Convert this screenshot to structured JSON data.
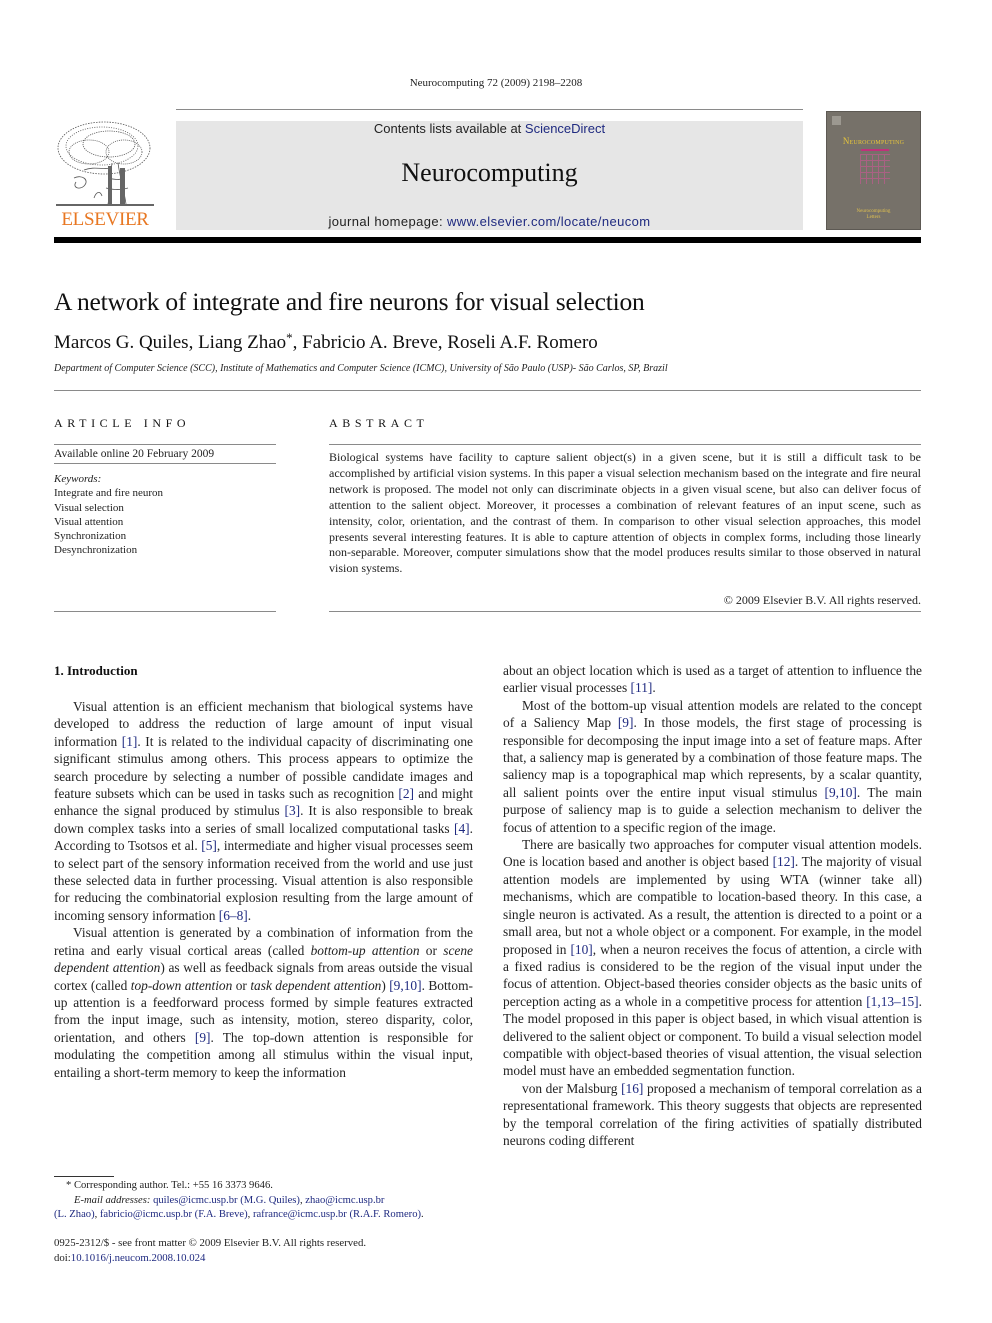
{
  "running_head": "Neurocomputing 72 (2009) 2198–2208",
  "publisher": {
    "logo_icon": "elsevier-tree-logo",
    "wordmark": "ELSEVIER",
    "brand_color": "#e87722"
  },
  "masthead": {
    "contents_prefix": "Contents lists available at ",
    "contents_link": "ScienceDirect",
    "journal_name": "Neurocomputing",
    "homepage_prefix": "journal homepage: ",
    "homepage_link": "www.elsevier.com/locate/neucom",
    "link_color": "#1f2a80",
    "background": "#e6e6e6"
  },
  "cover": {
    "title": "Neurocomputing",
    "subtitle_line1": "Neurocomputing",
    "subtitle_line2": "Letters"
  },
  "paper": {
    "title": "A network of integrate and fire neurons for visual selection",
    "authors": [
      {
        "name": "Marcos G. Quiles",
        "mark": ""
      },
      {
        "name": "Liang Zhao",
        "mark": "*"
      },
      {
        "name": "Fabricio A. Breve",
        "mark": ""
      },
      {
        "name": "Roseli A.F. Romero",
        "mark": ""
      }
    ],
    "affiliation": "Department of Computer Science (SCC), Institute of Mathematics and Computer Science (ICMC), University of São Paulo (USP)- São Carlos, SP, Brazil"
  },
  "article_info": {
    "heading": "ARTICLE INFO",
    "available": "Available online 20 February 2009",
    "keywords_label": "Keywords:",
    "keywords": [
      "Integrate and fire neuron",
      "Visual selection",
      "Visual attention",
      "Synchronization",
      "Desynchronization"
    ]
  },
  "abstract": {
    "heading": "ABSTRACT",
    "text": "Biological systems have facility to capture salient object(s) in a given scene, but it is still a difficult task to be accomplished by artificial vision systems. In this paper a visual selection mechanism based on the integrate and fire neural network is proposed. The model not only can discriminate objects in a given visual scene, but also can deliver focus of attention to the salient object. Moreover, it processes a combination of relevant features of an input scene, such as intensity, color, orientation, and the contrast of them. In comparison to other visual selection approaches, this model presents several interesting features. It is able to capture attention of objects in complex forms, including those linearly non-separable. Moreover, computer simulations show that the model produces results similar to those observed in natural vision systems.",
    "copyright": "© 2009 Elsevier B.V. All rights reserved."
  },
  "introduction": {
    "heading": "1.  Introduction",
    "left_column": [
      [
        {
          "t": "Visual attention is an efficient mechanism that biological systems have developed to address the reduction of large amount of input visual information "
        },
        {
          "ref": "[1]"
        },
        {
          "t": ". It is related to the individual capacity of discriminating one significant stimulus among others. This process appears to optimize the search procedure by selecting a number of possible candidate images and feature subsets which can be used in tasks such as recognition "
        },
        {
          "ref": "[2]"
        },
        {
          "t": " and might enhance the signal produced by stimulus "
        },
        {
          "ref": "[3]"
        },
        {
          "t": ". It is also responsible to break down complex tasks into a series of small localized computational tasks "
        },
        {
          "ref": "[4]"
        },
        {
          "t": ". According to Tsotsos et al. "
        },
        {
          "ref": "[5]"
        },
        {
          "t": ", intermediate and higher visual processes seem to select part of the sensory information received from the world and use just these selected data in further processing. Visual attention is also responsible for reducing the combinatorial explosion resulting from the large amount of incoming sensory information "
        },
        {
          "ref": "[6–8]"
        },
        {
          "t": "."
        }
      ],
      [
        {
          "t": "Visual attention is generated by a combination of information from the retina and early visual cortical areas (called "
        },
        {
          "i": "bottom-up attention"
        },
        {
          "t": " or "
        },
        {
          "i": "scene dependent attention"
        },
        {
          "t": ") as well as feedback signals from areas outside the visual cortex (called "
        },
        {
          "i": "top-down attention"
        },
        {
          "t": " or "
        },
        {
          "i": "task dependent attention"
        },
        {
          "t": ") "
        },
        {
          "ref": "[9,10]"
        },
        {
          "t": ". Bottom-up attention is a feedfor­ward process formed by simple features extracted from the input image, such as intensity, motion, stereo disparity, color, orienta­tion, and others "
        },
        {
          "ref": "[9]"
        },
        {
          "t": ". The top-down attention is responsible for modulating the competition among all stimulus within the visual input, entailing a short-term memory to keep the information"
        }
      ]
    ],
    "right_column": [
      [
        {
          "t": "about an object location which is used as a target of attention to influence the earlier visual processes "
        },
        {
          "ref": "[11]"
        },
        {
          "t": "."
        }
      ],
      [
        {
          "t": "Most of the bottom-up visual attention models are related to the concept of a Saliency Map "
        },
        {
          "ref": "[9]"
        },
        {
          "t": ". In those models, the first stage of processing is responsible for decomposing the input image into a set of feature maps. After that, a saliency map is generated by a combination of those feature maps. The saliency map is a topographical map which represents, by a scalar quantity, all salient points over the entire input visual stimulus "
        },
        {
          "ref": "[9,10]"
        },
        {
          "t": ". The main purpose of saliency map is to guide a selection mechanism to deliver the focus of attention to a specific region of the image."
        }
      ],
      [
        {
          "t": "There are basically two approaches for computer visual attention models. One is location based and another is object based "
        },
        {
          "ref": "[12]"
        },
        {
          "t": ". The majority of visual attention models are imple­mented by using WTA (winner take all) mechanisms, which are compatible to location-based theory. In this case, a single neuron is activated. As a result, the attention is directed to a point or a small area, but not a whole object or a component. For example, in the model proposed in "
        },
        {
          "ref": "[10]"
        },
        {
          "t": ", when a neuron receives the focus of attention, a circle with a fixed radius is considered to be the region of the visual input under the focus of attention. Object-based theories consider objects as the basic units of perception acting as a whole in a competitive process for attention "
        },
        {
          "ref": "[1,13–15]"
        },
        {
          "t": ". The model proposed in this paper is object based, in which visual attention is delivered to the salient object or component. To build a visual selection model compatible with object-based theories of visual attention, the visual selection model must have an embedded segmentation function."
        }
      ],
      [
        {
          "t": "von der Malsburg "
        },
        {
          "ref": "[16]"
        },
        {
          "t": " proposed a mechanism of temporal correlation as a representational framework. This theory suggests that objects are represented by the temporal correlation of the firing activities of spatially distributed neurons coding different"
        }
      ]
    ]
  },
  "footnote": {
    "corresponding": "* Corresponding author. Tel.: +55 16 3373 9646.",
    "email_label": "E-mail addresses:",
    "emails": [
      {
        "addr": "quiles@icmc.usp.br",
        "who": "(M.G. Quiles)"
      },
      {
        "addr": "zhao@icmc.usp.br",
        "who": "(L. Zhao)"
      },
      {
        "addr": "fabricio@icmc.usp.br",
        "who": "(F.A. Breve)"
      },
      {
        "addr": "rafrance@icmc.usp.br",
        "who": "(R.A.F. Romero)"
      }
    ]
  },
  "front_matter": {
    "issn_line": "0925-2312/$ - see front matter © 2009 Elsevier B.V. All rights reserved.",
    "doi_label": "doi:",
    "doi": "10.1016/j.neucom.2008.10.024"
  }
}
